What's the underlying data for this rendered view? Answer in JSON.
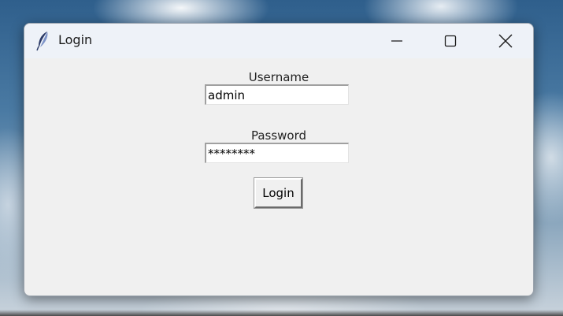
{
  "window": {
    "title": "Login",
    "controls": {
      "minimize_icon": "minimize-icon",
      "maximize_icon": "maximize-icon",
      "close_icon": "close-icon"
    },
    "app_icon": "feather-icon"
  },
  "form": {
    "username_label": "Username",
    "username_value": "admin",
    "password_label": "Password",
    "password_value": "********",
    "login_button_label": "Login"
  },
  "colors": {
    "window_background": "#f0f0f0",
    "titlebar_background": "#eef2f8",
    "entry_background": "#ffffff"
  }
}
